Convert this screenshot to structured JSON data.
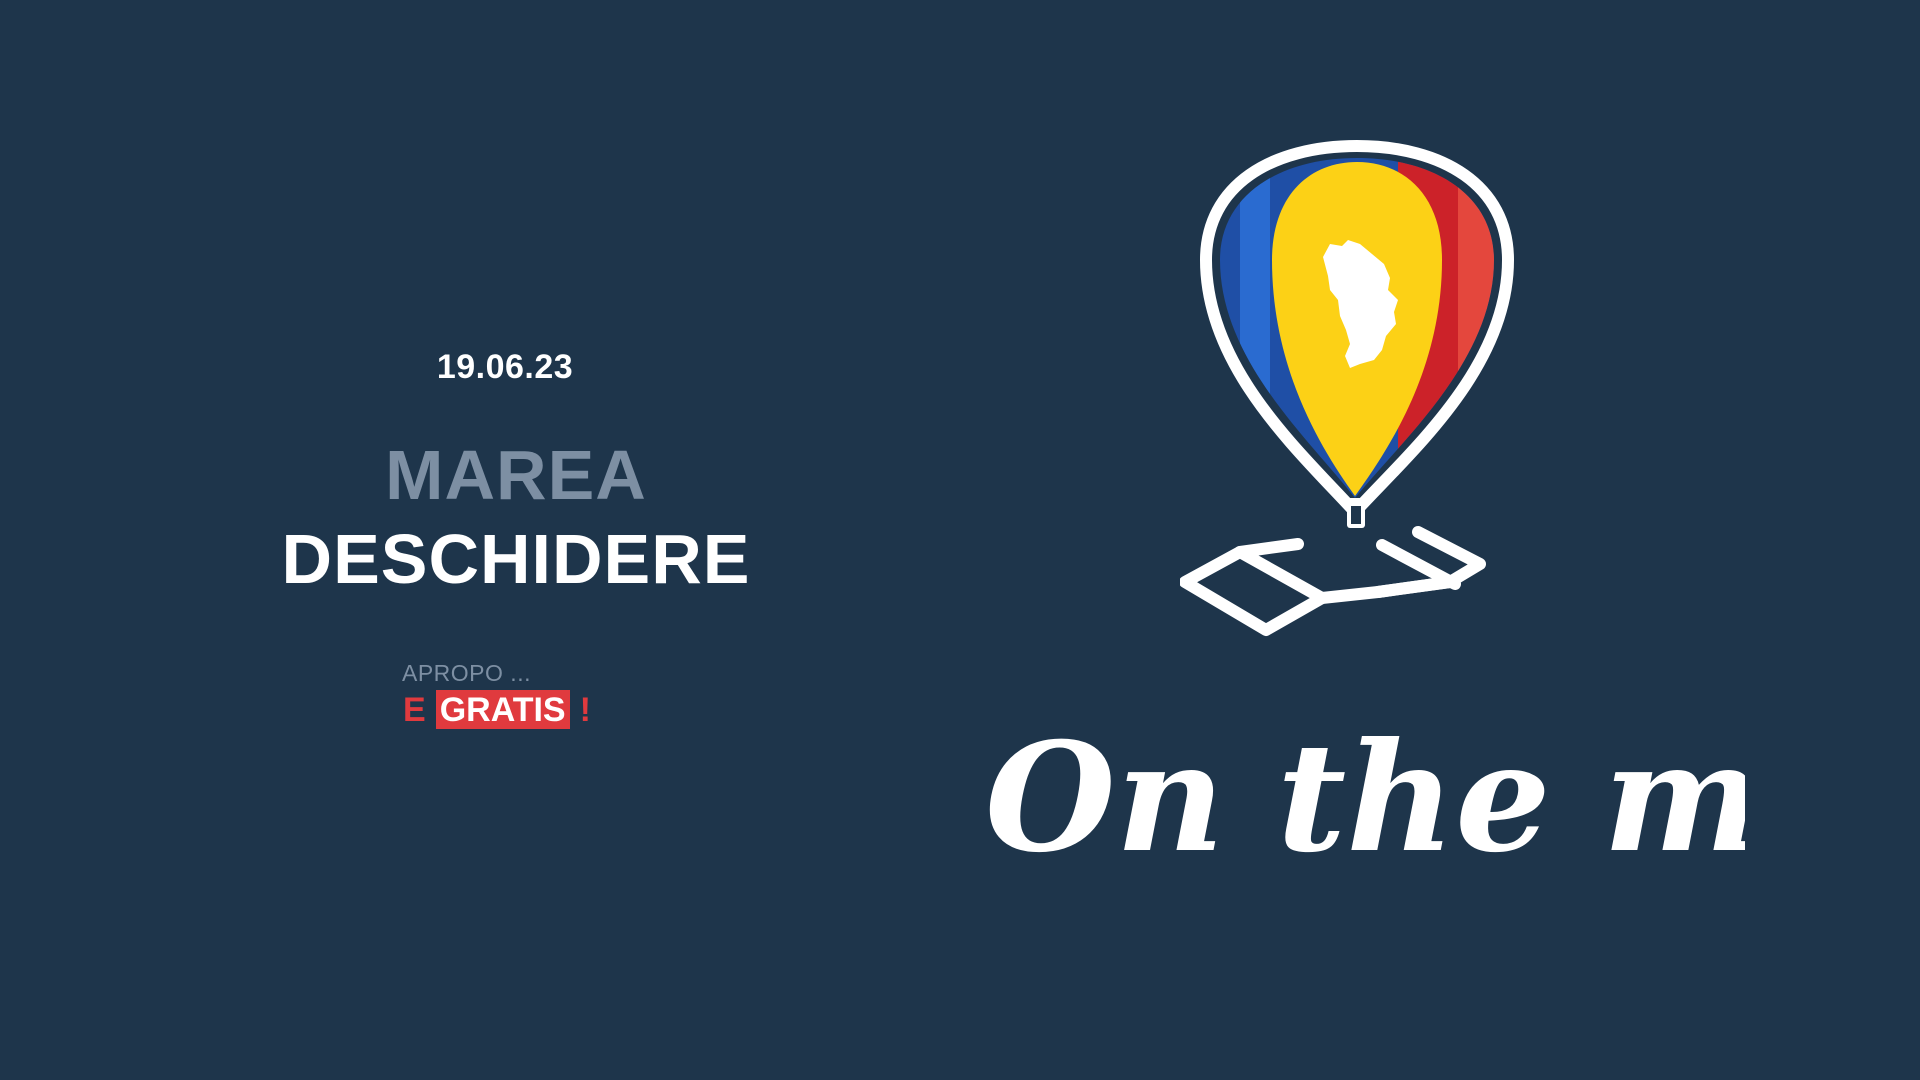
{
  "event": {
    "date": "19.06.23",
    "title_line1": "MAREA",
    "title_line2": "DESCHIDERE",
    "note": "APROPO ...",
    "free_prefix": "E",
    "free_word": "GRATIS",
    "free_suffix": "!"
  },
  "brand": {
    "tagline": "On the map",
    "logo_icon": "hot-air-balloon-map-pin-icon",
    "map_icon": "folded-map-icon",
    "country_icon": "moldova-silhouette-icon"
  },
  "colors": {
    "background": "#1e354b",
    "muted_text": "#7d8fa3",
    "accent_red": "#e03a3e",
    "flag_blue": "#1f4fa6",
    "flag_yellow": "#fcd116",
    "flag_red": "#cc2229"
  }
}
